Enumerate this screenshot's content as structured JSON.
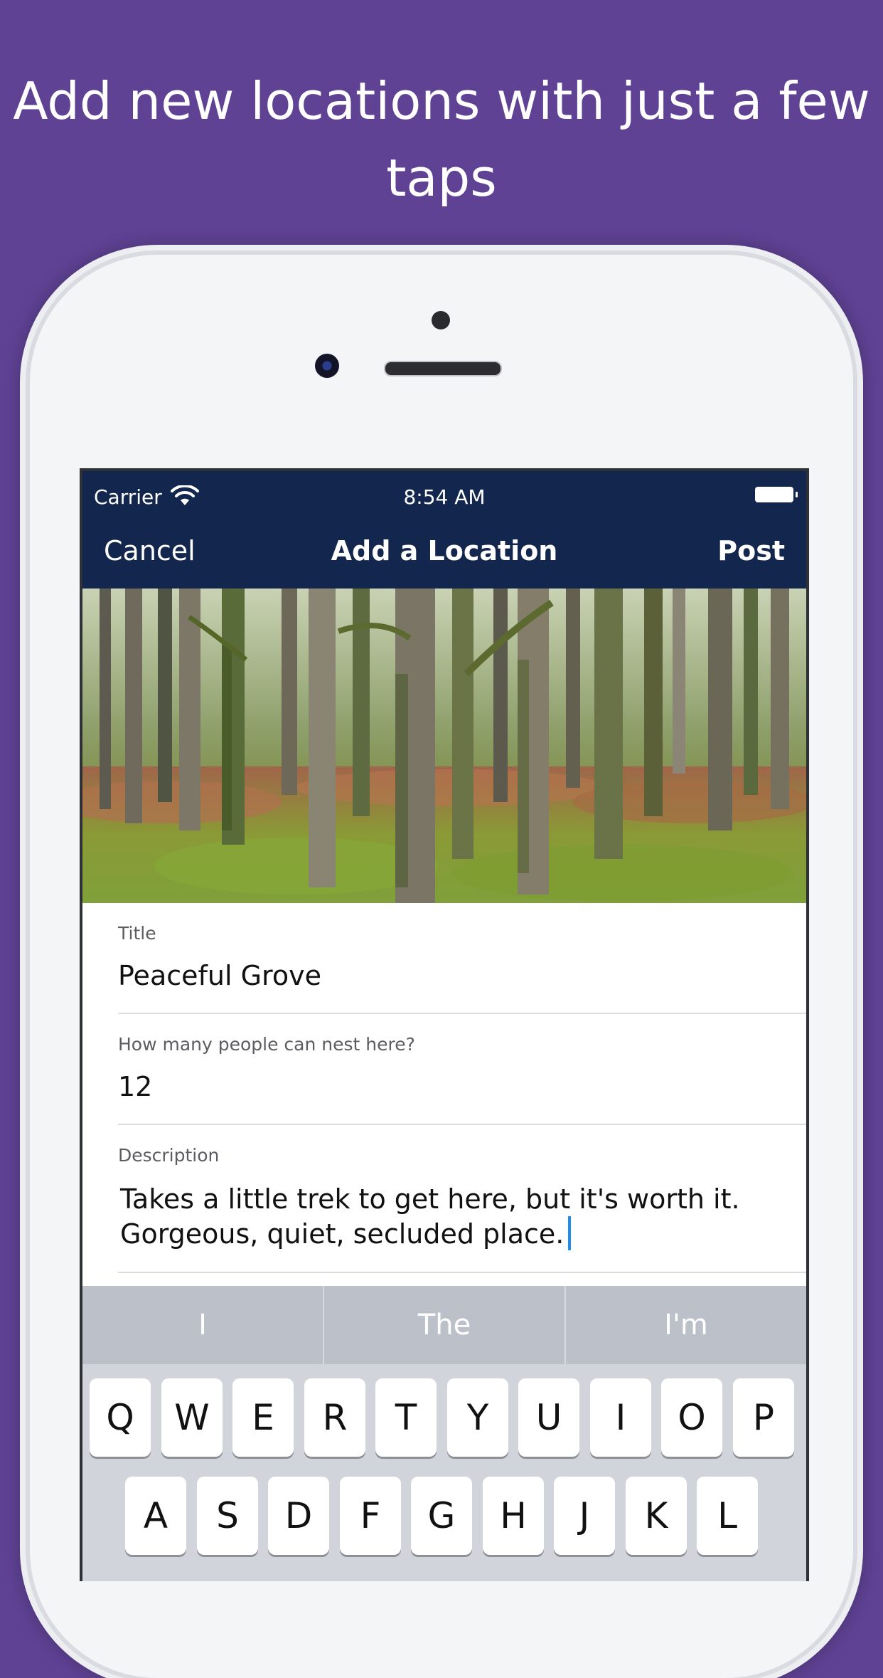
{
  "headline": "Add new locations with just a few taps",
  "status_bar": {
    "carrier": "Carrier",
    "time": "8:54 AM",
    "wifi_icon": "wifi-icon",
    "battery_icon": "battery-icon"
  },
  "navbar": {
    "cancel_label": "Cancel",
    "title": "Add a Location",
    "post_label": "Post",
    "background": "#13264d"
  },
  "photo": {
    "icon": "forest-photo"
  },
  "form": {
    "title_label": "Title",
    "title_value": "Peaceful Grove",
    "capacity_label": "How many people can nest here?",
    "capacity_value": "12",
    "description_label": "Description",
    "description_value": "Takes a little trek to get here, but it's worth it. Gorgeous, quiet, secluded place."
  },
  "keyboard": {
    "suggestions": [
      "I",
      "The",
      "I'm"
    ],
    "row1": [
      "Q",
      "W",
      "E",
      "R",
      "T",
      "Y",
      "U",
      "I",
      "O",
      "P"
    ],
    "row2": [
      "A",
      "S",
      "D",
      "F",
      "G",
      "H",
      "J",
      "K",
      "L"
    ]
  },
  "colors": {
    "background": "#5f4294",
    "caret": "#1f8cef"
  }
}
